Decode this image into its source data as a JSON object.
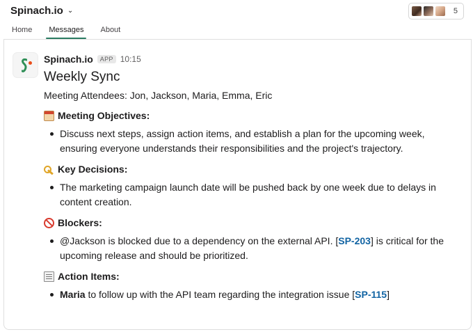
{
  "workspace": {
    "name": "Spinach.io"
  },
  "members": {
    "count": "5"
  },
  "tabs": [
    {
      "label": "Home"
    },
    {
      "label": "Messages"
    },
    {
      "label": "About"
    }
  ],
  "message": {
    "sender": "Spinach.io",
    "badge": "APP",
    "time": "10:15",
    "title": "Weekly Sync",
    "attendees": "Meeting Attendees: Jon, Jackson, Maria, Emma, Eric",
    "sections": {
      "objectives": {
        "icon": "calendar-icon",
        "heading": "Meeting Objectives:",
        "items": [
          "Discuss next steps, assign action items, and establish a plan for the upcoming week, ensuring everyone understands their responsibilities and the project's trajectory."
        ]
      },
      "decisions": {
        "icon": "key-icon",
        "heading": "Key Decisions:",
        "items": [
          "The marketing campaign launch date will be pushed back by one week due to delays in content creation."
        ]
      },
      "blockers": {
        "icon": "no-entry-icon",
        "heading": "Blockers:",
        "item_pre": "@Jackson is blocked due to a dependency on the external API. [",
        "item_ticket": "SP-203",
        "item_post": "] is critical for the upcoming release and should be prioritized."
      },
      "action_items": {
        "icon": "notepad-icon",
        "heading": "Action Items:",
        "item_owner": "Maria",
        "item_text": " to follow up with the API team regarding the integration issue [",
        "item_ticket": "SP-115",
        "item_post": "]"
      }
    }
  }
}
